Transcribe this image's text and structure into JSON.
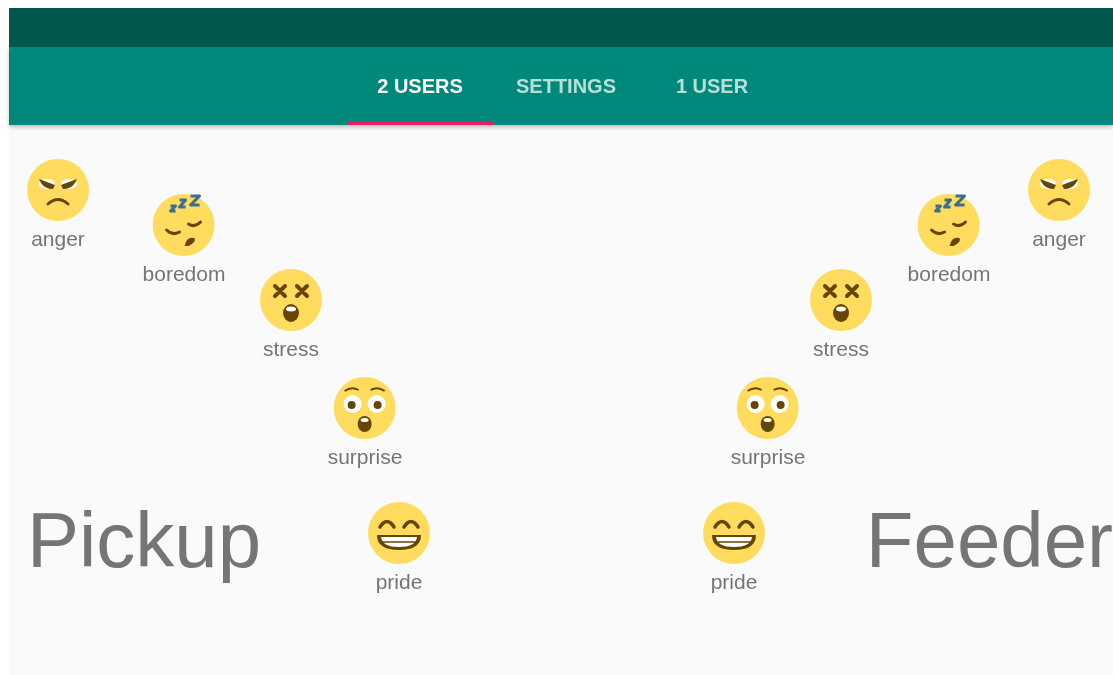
{
  "tabs": [
    {
      "label": "2 USERS",
      "selected": true
    },
    {
      "label": "SETTINGS",
      "selected": false
    },
    {
      "label": "1 USER",
      "selected": false
    }
  ],
  "panels": [
    {
      "kind": "left",
      "title": "Pickup",
      "emotions": [
        {
          "kind": "anger",
          "label": "anger"
        },
        {
          "kind": "boredom",
          "label": "boredom"
        },
        {
          "kind": "stress",
          "label": "stress"
        },
        {
          "kind": "surprise",
          "label": "surprise"
        },
        {
          "kind": "pride",
          "label": "pride"
        }
      ]
    },
    {
      "kind": "right",
      "title": "Feeder",
      "emotions": [
        {
          "kind": "anger",
          "label": "anger"
        },
        {
          "kind": "boredom",
          "label": "boredom"
        },
        {
          "kind": "stress",
          "label": "stress"
        },
        {
          "kind": "surprise",
          "label": "surprise"
        },
        {
          "kind": "pride",
          "label": "pride"
        }
      ]
    }
  ]
}
